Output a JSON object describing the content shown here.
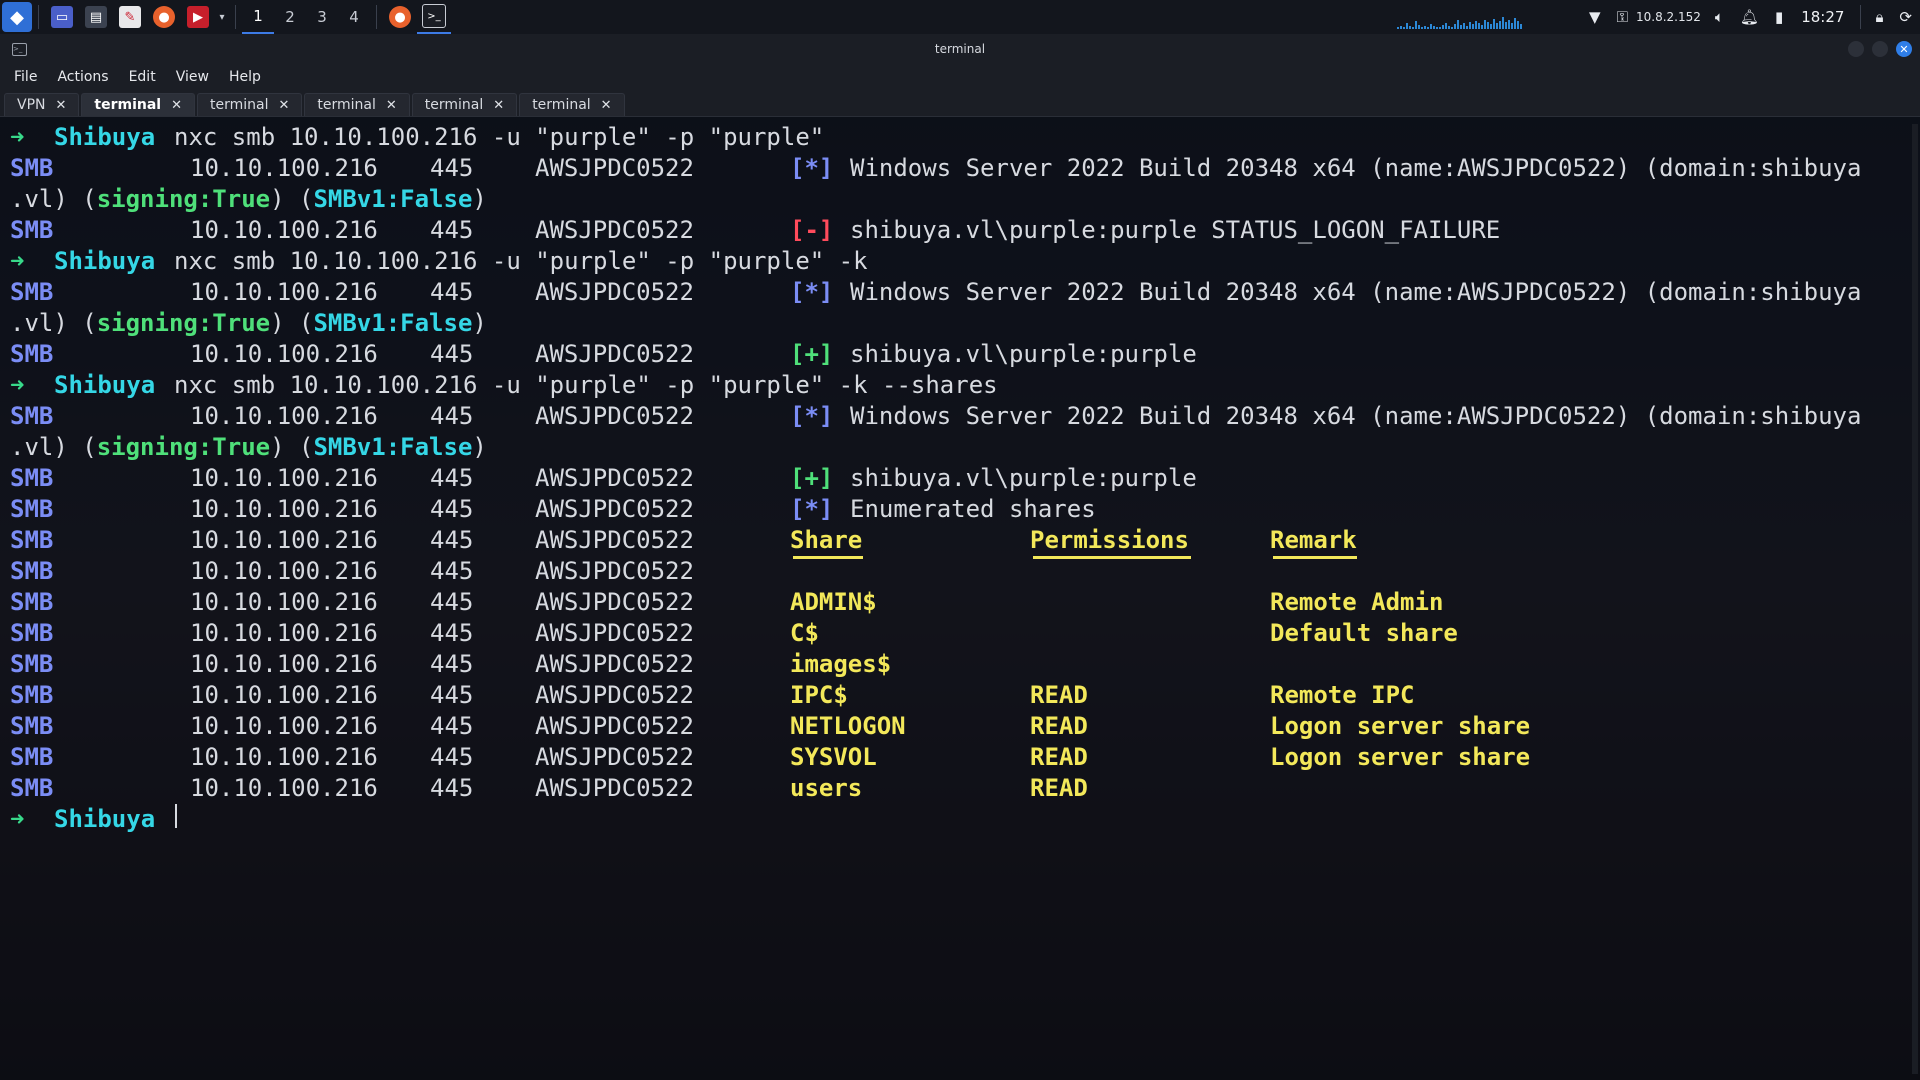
{
  "panel": {
    "workspaces": [
      "1",
      "2",
      "3",
      "4"
    ],
    "ip": "10.8.2.152",
    "clock": "18:27"
  },
  "window": {
    "title": "terminal"
  },
  "menu": [
    "File",
    "Actions",
    "Edit",
    "View",
    "Help"
  ],
  "tabs": [
    {
      "label": "VPN",
      "active": false
    },
    {
      "label": "terminal",
      "active": true
    },
    {
      "label": "terminal",
      "active": false
    },
    {
      "label": "terminal",
      "active": false
    },
    {
      "label": "terminal",
      "active": false
    },
    {
      "label": "terminal",
      "active": false
    }
  ],
  "tab_close": "✕",
  "prompt": {
    "arrow": "➜",
    "host": "Shibuya"
  },
  "commands": [
    "nxc smb 10.10.100.216 -u \"purple\" -p \"purple\"",
    "nxc smb 10.10.100.216 -u \"purple\" -p \"purple\" -k",
    "nxc smb 10.10.100.216 -u \"purple\" -p \"purple\" -k --shares"
  ],
  "smb": {
    "proto": "SMB",
    "ip": "10.10.100.216",
    "port": "445",
    "name": "AWSJPDC0522"
  },
  "flags": {
    "info": "[*]",
    "ok": "[+]",
    "bad": "[-]"
  },
  "messages": {
    "os": "Windows Server 2022 Build 20348 x64 (name:AWSJPDC0522) (domain:shibuya",
    "os_cont_prefix": ".vl) (",
    "signing": "signing:True",
    "mid": ") (",
    "smbv1": "SMBv1:False",
    "close": ")",
    "logon_fail": "shibuya.vl\\purple:purple STATUS_LOGON_FAILURE",
    "logon_ok": "shibuya.vl\\purple:purple",
    "enum": "Enumerated shares"
  },
  "shares": {
    "headers": {
      "share": "Share",
      "perm": "Permissions",
      "remark": "Remark"
    },
    "rows": [
      {
        "share": "ADMIN$",
        "perm": "",
        "remark": "Remote Admin"
      },
      {
        "share": "C$",
        "perm": "",
        "remark": "Default share"
      },
      {
        "share": "images$",
        "perm": "",
        "remark": ""
      },
      {
        "share": "IPC$",
        "perm": "READ",
        "remark": "Remote IPC"
      },
      {
        "share": "NETLOGON",
        "perm": "READ",
        "remark": "Logon server share"
      },
      {
        "share": "SYSVOL",
        "perm": "READ",
        "remark": "Logon server share"
      },
      {
        "share": "users",
        "perm": "READ",
        "remark": ""
      }
    ]
  },
  "colors": {
    "prompt_arrow": "#38d98a",
    "host": "#35d7e6",
    "smb": "#7b8df5",
    "ok": "#4fe07a",
    "bad": "#ff4b5c",
    "shares": "#f3e85a",
    "accent": "#3d7be6"
  }
}
